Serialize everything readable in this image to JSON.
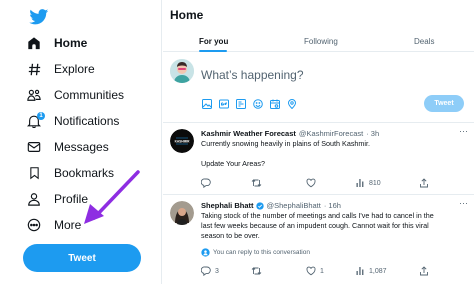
{
  "colors": {
    "brand": "#1d9bf0",
    "text": "#0f1419",
    "muted": "#536471",
    "border": "#e6ecf0",
    "arrow": "#8e2de2"
  },
  "sidebar": {
    "logo_icon": "twitter-bird-icon",
    "items": [
      {
        "label": "Home",
        "icon": "home-icon"
      },
      {
        "label": "Explore",
        "icon": "hashtag-icon"
      },
      {
        "label": "Communities",
        "icon": "communities-icon"
      },
      {
        "label": "Notifications",
        "icon": "bell-icon",
        "badge": "1"
      },
      {
        "label": "Messages",
        "icon": "envelope-icon"
      },
      {
        "label": "Bookmarks",
        "icon": "bookmark-icon"
      },
      {
        "label": "Profile",
        "icon": "person-icon"
      },
      {
        "label": "More",
        "icon": "more-circle-icon"
      }
    ],
    "tweet_button": "Tweet"
  },
  "main": {
    "title": "Home",
    "tabs": [
      "For you",
      "Following",
      "Deals"
    ],
    "active_tab": "For you",
    "compose": {
      "placeholder": "What’s happening?",
      "tweet_button": "Tweet"
    },
    "tweets": [
      {
        "name": "Kashmir Weather Forecast",
        "handle": "@KashmirForecast",
        "time": "· 3h",
        "lines": [
          "Currently snowing heavily in plains of South Kashmir.",
          "",
          "Update Your Areas?"
        ],
        "replies": "",
        "retweets": "",
        "likes": "",
        "views": "810"
      },
      {
        "name": "Shephali Bhatt",
        "verified": true,
        "handle": "@ShephaliBhatt",
        "time": "· 16h",
        "lines": [
          "Taking stock of the number of meetings and calls I've had to cancel in the",
          "last few weeks because of an impudent cough. Cannot wait for this viral",
          "season to be over."
        ],
        "reply_note": "You can reply to this conversation",
        "replies": "3",
        "retweets": "",
        "likes": "1",
        "views": "1,087"
      }
    ]
  }
}
